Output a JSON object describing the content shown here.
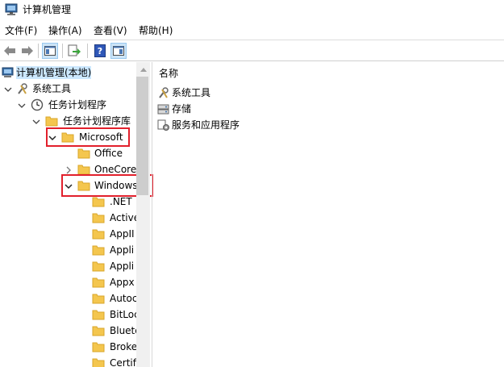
{
  "window": {
    "title": "计算机管理"
  },
  "menu": [
    {
      "label": "文件(F)"
    },
    {
      "label": "操作(A)"
    },
    {
      "label": "查看(V)"
    },
    {
      "label": "帮助(H)"
    }
  ],
  "toolbar": {
    "buttons": [
      "back-arrow-icon",
      "forward-arrow-icon",
      "show-hide-tree-icon",
      "export-list-icon",
      "help-icon",
      "action-pane-icon"
    ]
  },
  "tree": {
    "root": "计算机管理(本地)",
    "system_tools": "系统工具",
    "task_scheduler": "任务计划程序",
    "task_library": "任务计划程序库",
    "microsoft": "Microsoft",
    "office": "Office",
    "onecore": "OneCore",
    "windows": "Windows",
    "children": [
      ".NET",
      "Active",
      "AppII",
      "Appli",
      "Appli",
      "Appx",
      "Autoc",
      "BitLoc",
      "Blueto",
      "Broke",
      "Certif"
    ]
  },
  "right": {
    "column": "名称",
    "items": [
      "系统工具",
      "存储",
      "服务和应用程序"
    ]
  },
  "colors": {
    "highlight_box": "#e2202c",
    "folder": "#f4c64e",
    "selection": "#cce8ff"
  }
}
